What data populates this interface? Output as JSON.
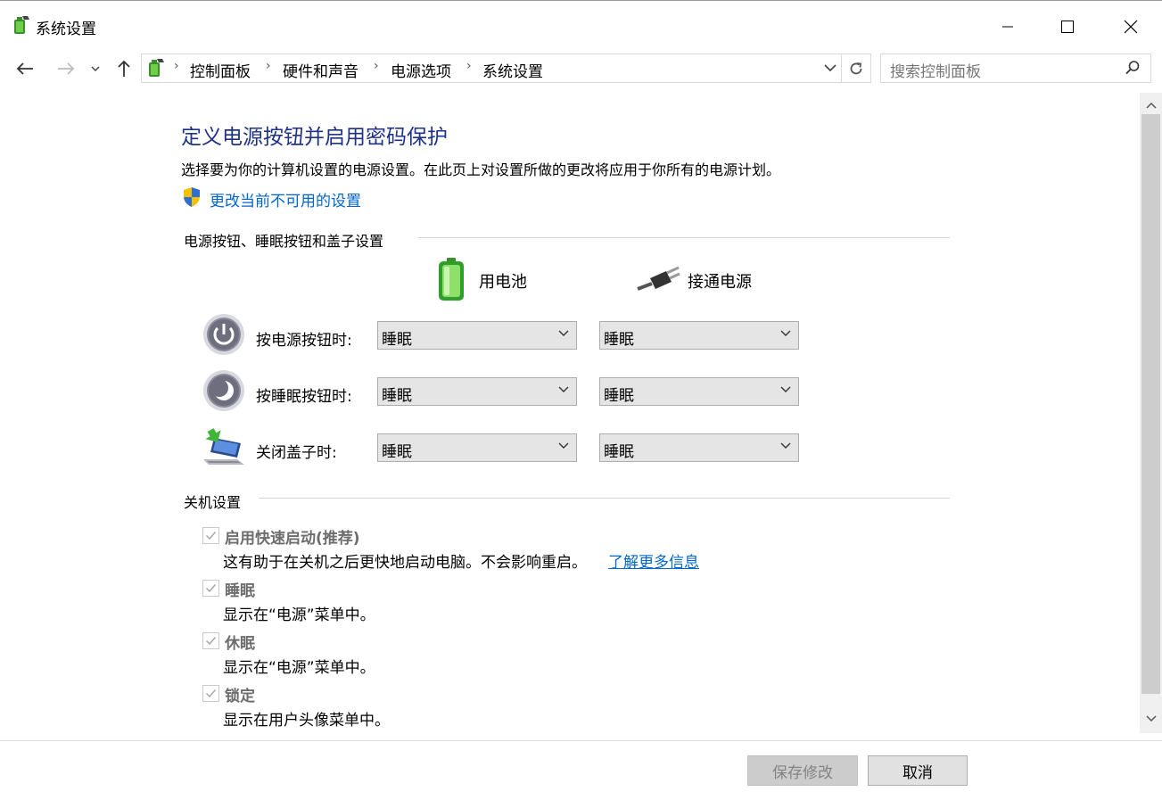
{
  "window": {
    "title": "系统设置",
    "minimize_icon": "minimize-icon",
    "maximize_icon": "maximize-icon",
    "close_icon": "close-icon"
  },
  "nav": {
    "breadcrumbs": [
      "控制面板",
      "硬件和声音",
      "电源选项",
      "系统设置"
    ],
    "search_placeholder": "搜索控制面板"
  },
  "content": {
    "heading": "定义电源按钮并启用密码保护",
    "description": "选择要为你的计算机设置的电源设置。在此页上对设置所做的更改将应用于你所有的电源计划。",
    "admin_link": "更改当前不可用的设置",
    "power_section": {
      "label": "电源按钮、睡眠按钮和盖子设置",
      "col_battery": "用电池",
      "col_plugged": "接通电源",
      "rows": [
        {
          "label": "按电源按钮时:",
          "battery": "睡眠",
          "plugged": "睡眠",
          "icon": "power-button-icon"
        },
        {
          "label": "按睡眠按钮时:",
          "battery": "睡眠",
          "plugged": "睡眠",
          "icon": "sleep-button-icon"
        },
        {
          "label": "关闭盖子时:",
          "battery": "睡眠",
          "plugged": "睡眠",
          "icon": "laptop-lid-icon"
        }
      ]
    },
    "shutdown_section": {
      "label": "关机设置",
      "items": [
        {
          "label": "启用快速启动(推荐)",
          "desc": "这有助于在关机之后更快地启动电脑。不会影响重启。",
          "link": "了解更多信息",
          "checked": true
        },
        {
          "label": "睡眠",
          "desc": "显示在“电源”菜单中。",
          "checked": true
        },
        {
          "label": "休眠",
          "desc": "显示在“电源”菜单中。",
          "checked": true
        },
        {
          "label": "锁定",
          "desc": "显示在用户头像菜单中。",
          "checked": true
        }
      ]
    }
  },
  "footer": {
    "save_label": "保存修改",
    "cancel_label": "取消"
  },
  "colors": {
    "heading": "#1e3287",
    "link": "#0066cc"
  }
}
